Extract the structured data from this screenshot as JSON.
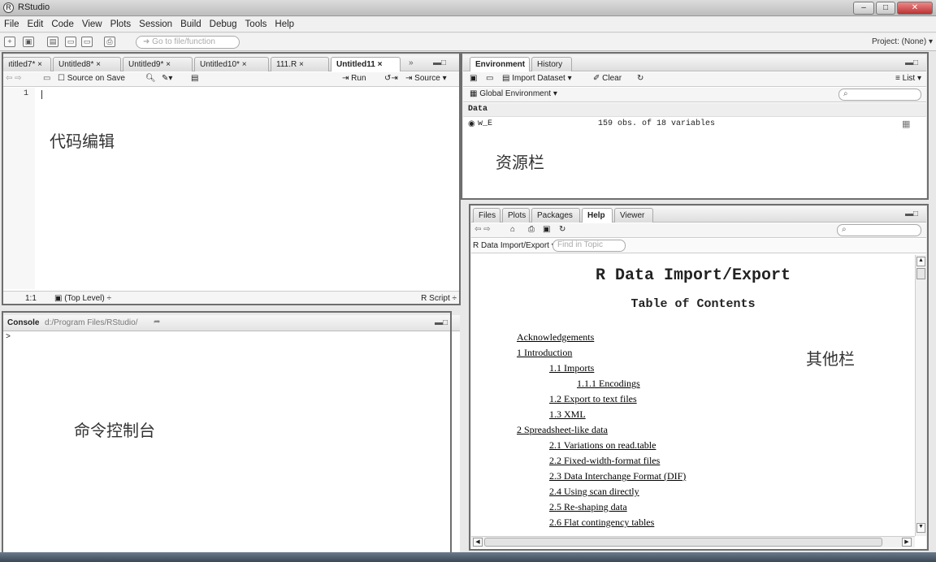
{
  "window": {
    "title": "RStudio"
  },
  "menu": [
    "File",
    "Edit",
    "Code",
    "View",
    "Plots",
    "Session",
    "Build",
    "Debug",
    "Tools",
    "Help"
  ],
  "toolbar": {
    "goto_placeholder": "Go to file/function",
    "project": "Project: (None) ▾"
  },
  "editor": {
    "tabs": [
      "ıtitled7* ×",
      "Untitled8* ×",
      "Untitled9* ×",
      "Untitled10* ×",
      "111.R ×",
      "Untitled11 ×"
    ],
    "overflow": "»",
    "source_on_save": "Source on Save",
    "run": "Run",
    "source": "Source",
    "line_number": "1",
    "status_pos": "1:1",
    "status_scope": "(Top Level) ÷",
    "status_type": "R Script ÷",
    "annotation": "代码编辑"
  },
  "console": {
    "label": "Console",
    "path": "d:/Program Files/RStudio/",
    "prompt": ">",
    "annotation": "命令控制台"
  },
  "environment": {
    "tabs": [
      "Environment",
      "History"
    ],
    "import_dataset": "Import Dataset ▾",
    "clear": "Clear",
    "list": "List ▾",
    "global_env": "Global Environment ▾",
    "section": "Data",
    "row_name": "w_E",
    "row_value": "159 obs. of 18 variables",
    "annotation": "资源栏"
  },
  "files": {
    "tabs": [
      "Files",
      "Plots",
      "Packages",
      "Help",
      "Viewer"
    ],
    "topic": "R Data Import/Export ▾",
    "find_placeholder": "Find in Topic",
    "help_title": "R Data Import/Export",
    "help_subtitle": "Table of Contents",
    "toc": [
      "Acknowledgements",
      "1 Introduction",
      "1.1 Imports",
      "1.1.1 Encodings",
      "1.2 Export to text files",
      "1.3 XML",
      "2 Spreadsheet-like data",
      "2.1 Variations on read.table",
      "2.2 Fixed-width-format files",
      "2.3 Data Interchange Format (DIF)",
      "2.4 Using scan directly",
      "2.5 Re-shaping data",
      "2.6 Flat contingency tables"
    ],
    "annotation": "其他栏"
  }
}
